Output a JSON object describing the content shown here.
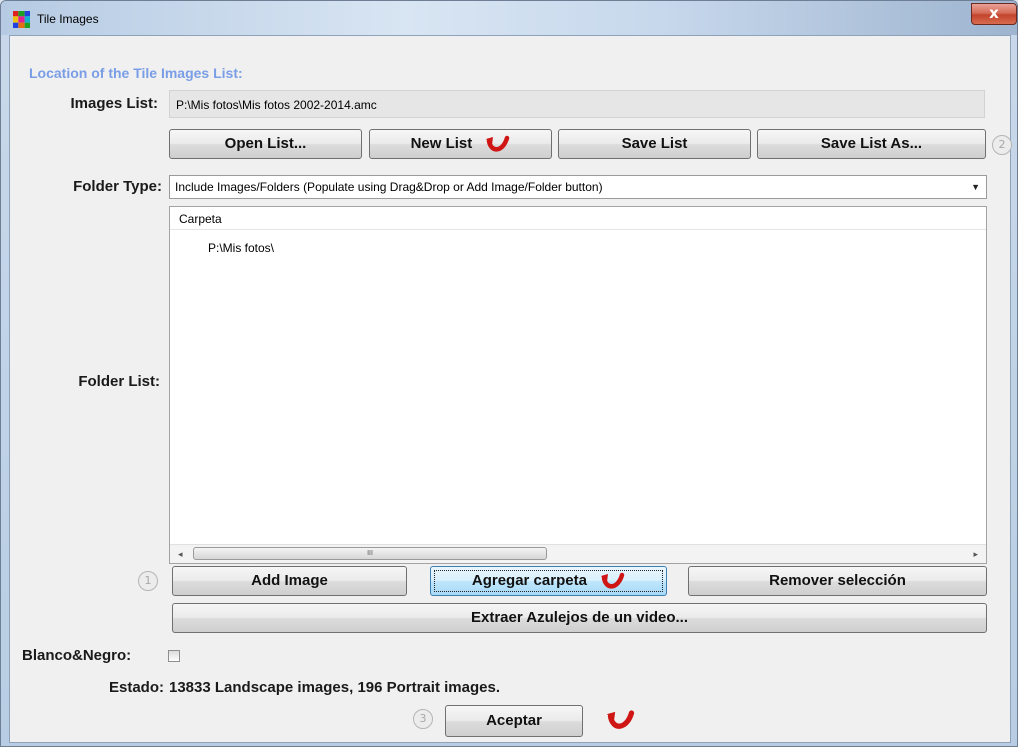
{
  "window": {
    "title": "Tile Images",
    "close_glyph": "x"
  },
  "section_title": "Location of the Tile Images List:",
  "images_list": {
    "label": "Images List:",
    "value": "P:\\Mis fotos\\Mis fotos 2002-2014.amc"
  },
  "list_buttons": {
    "open": "Open List...",
    "new": "New List",
    "save": "Save List",
    "save_as": "Save List As..."
  },
  "folder_type": {
    "label": "Folder Type:",
    "selected": "Include Images/Folders (Populate using Drag&Drop or Add Image/Folder button)"
  },
  "folder_list": {
    "label": "Folder List:",
    "column_header": "Carpeta",
    "items": [
      "P:\\Mis fotos\\"
    ]
  },
  "scrollbar": {
    "left_arrow": "◂",
    "right_arrow": "▸",
    "thumb_grip": "III"
  },
  "folder_buttons": {
    "add_image": "Add Image",
    "add_folder": "Agregar carpeta",
    "remove": "Remover selección",
    "extract_video": "Extraer Azulejos de un video..."
  },
  "bw": {
    "label": "Blanco&Negro:",
    "checked": false
  },
  "status": {
    "label": "Estado:",
    "text": "13833 Landscape images, 196 Portrait images."
  },
  "accept_button": "Aceptar",
  "step_badges": {
    "one": "1",
    "two": "2",
    "three": "3"
  },
  "icons": {
    "app": "tile-images-app-icon",
    "arrow": "red-curved-arrow-icon"
  },
  "colors": {
    "section_title": "#7a9ee6",
    "arrow": "#d01515",
    "close": "#c3432c"
  }
}
